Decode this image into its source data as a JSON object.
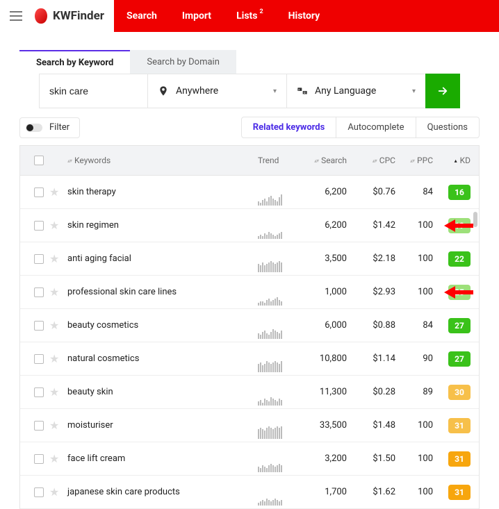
{
  "header": {
    "brand": "KWFinder",
    "nav": [
      {
        "label": "Search",
        "active": true
      },
      {
        "label": "Import"
      },
      {
        "label": "Lists",
        "sup": "2"
      },
      {
        "label": "History"
      }
    ]
  },
  "tabs": {
    "items": [
      {
        "label": "Search by Keyword",
        "active": true
      },
      {
        "label": "Search by Domain"
      }
    ]
  },
  "search": {
    "value": "skin care",
    "location_label": "Anywhere",
    "language_label": "Any Language"
  },
  "filter": {
    "label": "Filter"
  },
  "subtabs": {
    "items": [
      {
        "label": "Related keywords",
        "active": true
      },
      {
        "label": "Autocomplete"
      },
      {
        "label": "Questions"
      }
    ]
  },
  "columns": {
    "keywords": "Keywords",
    "trend": "Trend",
    "search": "Search",
    "cpc": "CPC",
    "ppc": "PPC",
    "kd": "KD"
  },
  "rows": [
    {
      "kw": "skin therapy",
      "search": "6,200",
      "cpc": "$0.76",
      "ppc": "84",
      "kd": "16",
      "kd_color": "#3ac21a",
      "arrow": false,
      "spark": [
        3,
        2,
        4,
        5,
        3,
        6,
        7,
        5,
        4,
        3,
        6,
        8
      ]
    },
    {
      "kw": "skin regimen",
      "search": "6,200",
      "cpc": "$1.42",
      "ppc": "100",
      "kd": "19",
      "kd_color": "#9de07a",
      "arrow": true,
      "spark": [
        2,
        3,
        2,
        4,
        3,
        5,
        4,
        3,
        2,
        3,
        4,
        5
      ]
    },
    {
      "kw": "anti aging facial",
      "search": "3,500",
      "cpc": "$2.18",
      "ppc": "100",
      "kd": "22",
      "kd_color": "#3ac21a",
      "arrow": false,
      "spark": [
        6,
        5,
        7,
        5,
        6,
        7,
        8,
        7,
        6,
        7,
        8,
        7
      ]
    },
    {
      "kw": "professional skin care lines",
      "search": "1,000",
      "cpc": "$2.93",
      "ppc": "100",
      "kd": "25",
      "kd_color": "#9de07a",
      "arrow": true,
      "spark": [
        2,
        3,
        3,
        2,
        4,
        5,
        3,
        4,
        5,
        6,
        4,
        3
      ]
    },
    {
      "kw": "beauty cosmetics",
      "search": "6,000",
      "cpc": "$0.88",
      "ppc": "84",
      "kd": "27",
      "kd_color": "#3ac21a",
      "arrow": false,
      "spark": [
        4,
        3,
        5,
        6,
        4,
        3,
        5,
        7,
        6,
        5,
        4,
        6
      ]
    },
    {
      "kw": "natural cosmetics",
      "search": "10,800",
      "cpc": "$1.14",
      "ppc": "90",
      "kd": "27",
      "kd_color": "#3ac21a",
      "arrow": false,
      "spark": [
        6,
        7,
        5,
        6,
        8,
        7,
        6,
        7,
        8,
        7,
        6,
        8
      ]
    },
    {
      "kw": "beauty skin",
      "search": "11,300",
      "cpc": "$0.28",
      "ppc": "89",
      "kd": "30",
      "kd_color": "#f7c04a",
      "arrow": false,
      "spark": [
        3,
        4,
        2,
        5,
        4,
        3,
        6,
        5,
        4,
        3,
        5,
        4
      ]
    },
    {
      "kw": "moisturiser",
      "search": "33,500",
      "cpc": "$1.48",
      "ppc": "100",
      "kd": "31",
      "kd_color": "#f7c04a",
      "arrow": false,
      "spark": [
        7,
        8,
        7,
        6,
        8,
        9,
        8,
        7,
        8,
        9,
        8,
        9
      ]
    },
    {
      "kw": "face lift cream",
      "search": "3,200",
      "cpc": "$1.50",
      "ppc": "100",
      "kd": "31",
      "kd_color": "#f7a60e",
      "arrow": false,
      "spark": [
        4,
        3,
        5,
        4,
        3,
        5,
        6,
        5,
        4,
        5,
        6,
        5
      ]
    },
    {
      "kw": "japanese skin care products",
      "search": "1,700",
      "cpc": "$1.62",
      "ppc": "100",
      "kd": "31",
      "kd_color": "#f7a60e",
      "arrow": false,
      "spark": [
        2,
        3,
        4,
        3,
        5,
        4,
        3,
        4,
        5,
        4,
        3,
        4
      ]
    }
  ]
}
